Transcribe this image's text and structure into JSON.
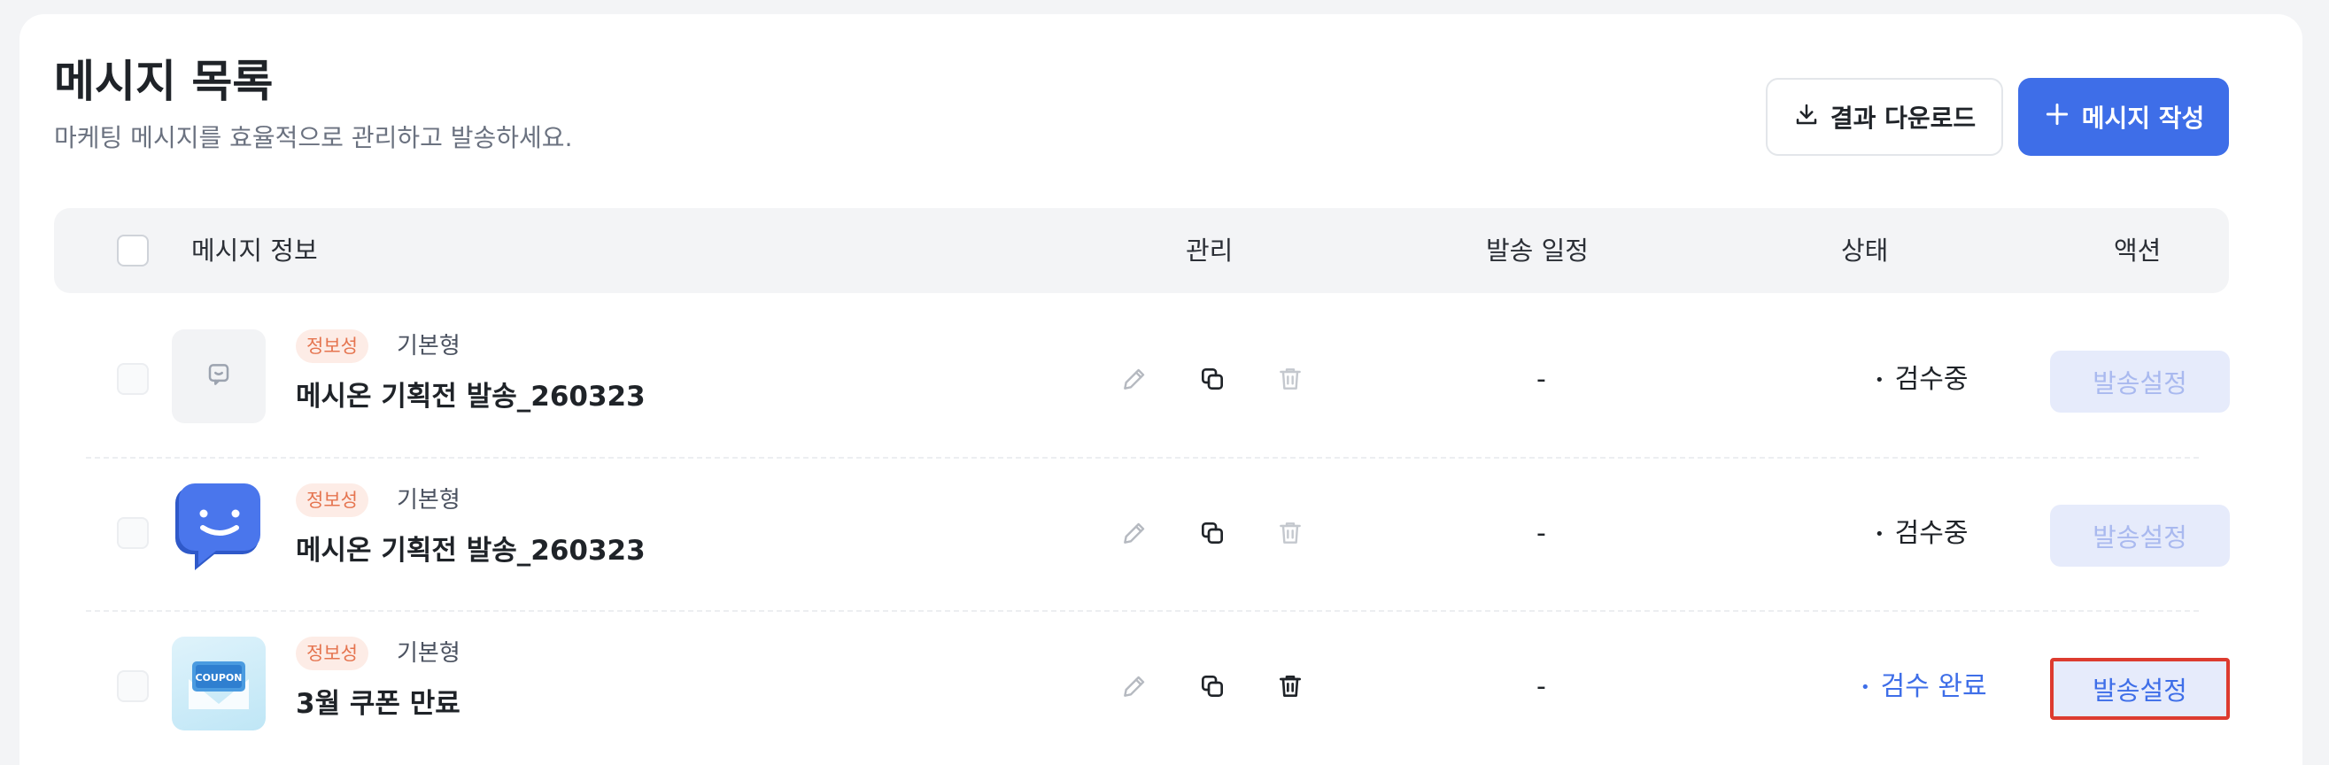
{
  "header": {
    "title": "메시지 목록",
    "subtitle": "마케팅 메시지를 효율적으로 관리하고 발송하세요.",
    "download_label": "결과 다운로드",
    "create_label": "메시지 작성"
  },
  "table": {
    "columns": {
      "info": "메시지 정보",
      "manage": "관리",
      "schedule": "발송 일정",
      "status": "상태",
      "action": "액션"
    },
    "rows": [
      {
        "tag": "정보성",
        "type": "기본형",
        "name": "메시온 기획전 발송_260323",
        "thumbnail": "placeholder-chat-icon",
        "schedule": "-",
        "status": "검수중",
        "status_dot": "•",
        "status_color": "#1f2328",
        "action": "발송설정",
        "action_enabled": false,
        "delete_enabled": false
      },
      {
        "tag": "정보성",
        "type": "기본형",
        "name": "메시온 기획전 발송_260323",
        "thumbnail": "brand-chat-logo",
        "schedule": "-",
        "status": "검수중",
        "status_dot": "•",
        "status_color": "#1f2328",
        "action": "발송설정",
        "action_enabled": false,
        "delete_enabled": false
      },
      {
        "tag": "정보성",
        "type": "기본형",
        "name": "3월 쿠폰 만료",
        "thumbnail": "coupon-image",
        "thumbnail_text": "COUPON",
        "schedule": "-",
        "status": "검수 완료",
        "status_dot": "•",
        "status_color": "#3e6ee8",
        "action": "발송설정",
        "action_enabled": true,
        "delete_enabled": true
      }
    ]
  },
  "colors": {
    "accent": "#3e6ee8",
    "tag_bg": "#fdece6",
    "tag_text": "#e5744f",
    "highlight_border": "#dd3b2f"
  },
  "icons": {
    "download": "download-icon",
    "create": "plus-icon",
    "edit": "pencil-icon",
    "copy": "copy-icon",
    "delete": "trash-icon"
  }
}
